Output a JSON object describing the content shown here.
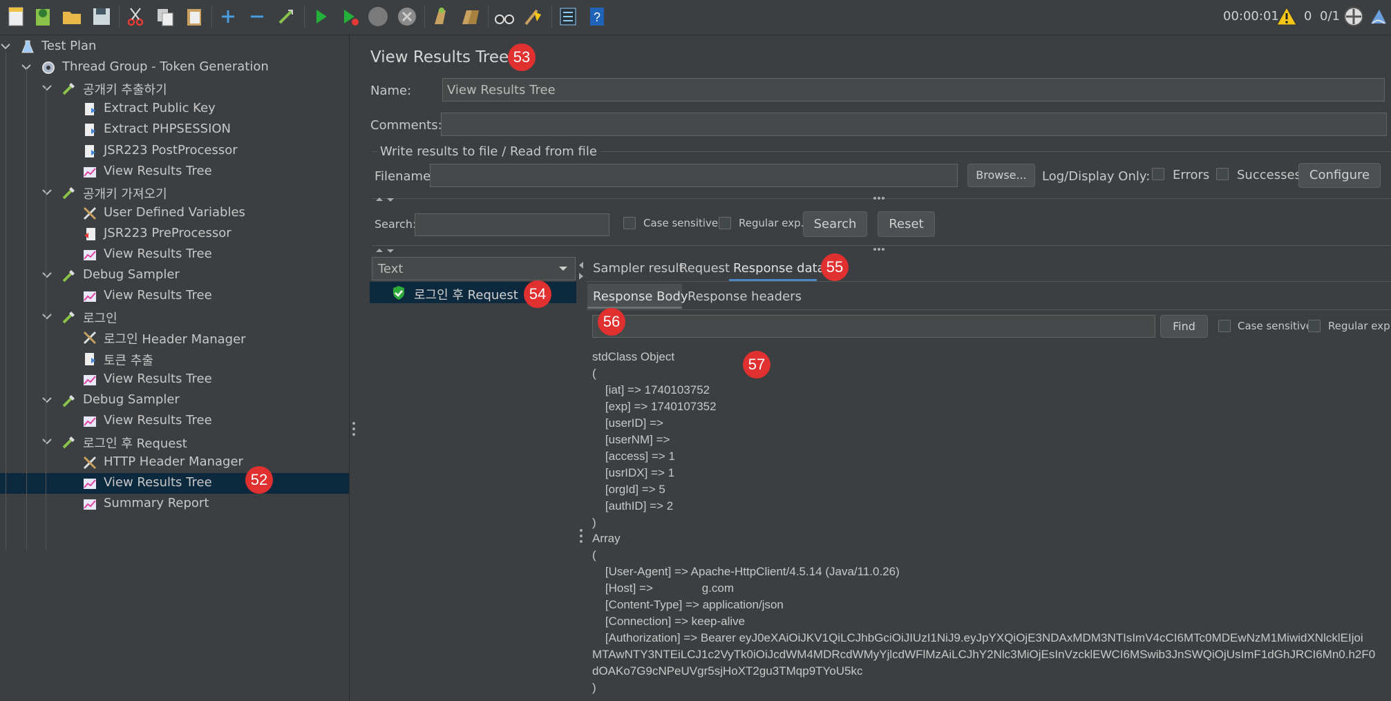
{
  "status": {
    "elapsed": "00:00:01",
    "warnings": "0",
    "threads": "0/1"
  },
  "tree": {
    "items": [
      {
        "label": "Test Plan",
        "icon": "flask-icon"
      },
      {
        "label": "Thread Group - Token Generation",
        "icon": "gear-icon"
      },
      {
        "label": "공개키 추출하기",
        "icon": "pipette-icon"
      },
      {
        "label": "Extract Public Key",
        "icon": "postprocessor-icon"
      },
      {
        "label": "Extract PHPSESSION",
        "icon": "postprocessor-icon"
      },
      {
        "label": "JSR223 PostProcessor",
        "icon": "postprocessor-icon"
      },
      {
        "label": "View Results Tree",
        "icon": "chart-icon"
      },
      {
        "label": "공개키 가져오기",
        "icon": "pipette-icon"
      },
      {
        "label": "User Defined Variables",
        "icon": "tools-icon"
      },
      {
        "label": "JSR223 PreProcessor",
        "icon": "preprocessor-icon"
      },
      {
        "label": "View Results Tree",
        "icon": "chart-icon"
      },
      {
        "label": "Debug Sampler",
        "icon": "pipette-icon"
      },
      {
        "label": "View Results Tree",
        "icon": "chart-icon"
      },
      {
        "label": "로그인",
        "icon": "pipette-icon"
      },
      {
        "label": "로그인 Header Manager",
        "icon": "tools-icon"
      },
      {
        "label": "토큰 추출",
        "icon": "postprocessor-icon"
      },
      {
        "label": "View Results Tree",
        "icon": "chart-icon"
      },
      {
        "label": "Debug Sampler",
        "icon": "pipette-icon"
      },
      {
        "label": "View Results Tree",
        "icon": "chart-icon"
      },
      {
        "label": "로그인 후 Request",
        "icon": "pipette-icon"
      },
      {
        "label": "HTTP Header Manager",
        "icon": "tools-icon"
      },
      {
        "label": "View Results Tree",
        "icon": "chart-icon"
      },
      {
        "label": "Summary Report",
        "icon": "chart-icon"
      }
    ]
  },
  "badges": {
    "b52": "52",
    "b53": "53",
    "b54": "54",
    "b55": "55",
    "b56": "56",
    "b57": "57"
  },
  "panel": {
    "title": "View Results Tree",
    "name_label": "Name:",
    "name_value": "View Results Tree",
    "comments_label": "Comments:",
    "comments_value": "",
    "file_section": "Write results to file / Read from file",
    "filename_label": "Filename",
    "filename_value": "",
    "browse": "Browse...",
    "log_display": "Log/Display Only:",
    "errors": "Errors",
    "successes": "Successes",
    "configure": "Configure",
    "search_label": "Search:",
    "search_value": "",
    "case_sensitive": "Case sensitive",
    "regular_exp": "Regular exp.",
    "search_btn": "Search",
    "reset_btn": "Reset",
    "renderer": "Text",
    "result_item": "로그인 후 Request",
    "tabs": [
      "Sampler result",
      "Request",
      "Response data"
    ],
    "subtabs": [
      "Response Body",
      "Response headers"
    ],
    "find_btn": "Find",
    "find_case": "Case sensitive",
    "find_regex": "Regular exp.",
    "find_value": ""
  },
  "response": {
    "lines": [
      "stdClass Object",
      "(",
      "    [iat] => 1740103752",
      "    [exp] => 1740107352",
      "    [userID] =>",
      "    [userNM] =>",
      "    [access] => 1",
      "    [usrIDX] => 1",
      "    [orgId] => 5",
      "    [authID] => 2",
      ")",
      "Array",
      "(",
      "    [User-Agent] => Apache-HttpClient/4.5.14 (Java/11.0.26)",
      "    [Host] =>               g.com",
      "    [Content-Type] => application/json",
      "    [Connection] => keep-alive",
      "    [Authorization] => Bearer eyJ0eXAiOiJKV1QiLCJhbGciOiJIUzI1NiJ9.eyJpYXQiOjE3NDAxMDM3NTIsImV4cCI6MTc0MDEwNzM1MiwidXNlcklEIjoi",
      "MTAwNTY3NTEiLCJ1c2VyTk0iOiJcdWM4MDRcdWMyYjlcdWFlMzAiLCJhY2Nlc3MiOjEsInVzcklEWCI6MSwib3JnSWQiOjUsImF1dGhJRCI6Mn0.h2F0",
      "dOAKo7G9cNPeUVgr5sjHoXT2gu3TMqp9TYoU5kc",
      ")"
    ]
  },
  "colors": {
    "background": "#3c3f41",
    "selection": "#0d293e",
    "badge": "#e03030",
    "accent": "#4a88c7"
  }
}
